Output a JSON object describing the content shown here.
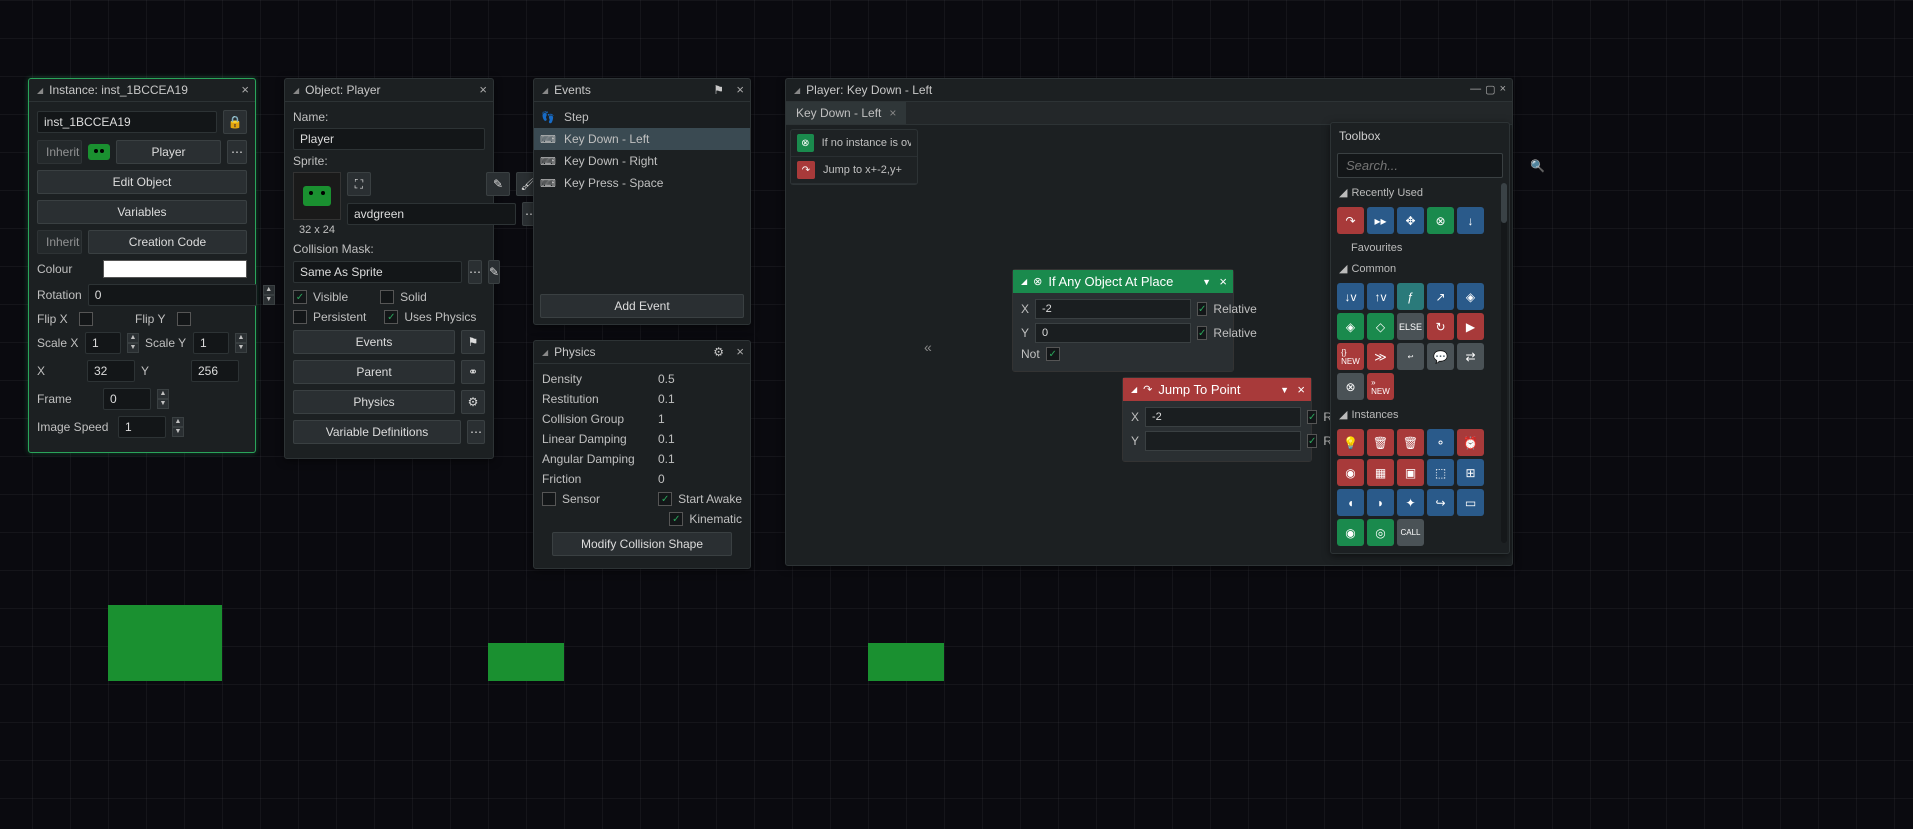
{
  "instance_panel": {
    "title": "Instance: inst_1BCCEA19",
    "name_value": "inst_1BCCEA19",
    "inherit_label": "Inherit",
    "object_name": "Player",
    "edit_object": "Edit Object",
    "variables": "Variables",
    "inherit2": "Inherit",
    "creation_code": "Creation Code",
    "colour_label": "Colour",
    "rotation_label": "Rotation",
    "rotation_value": "0",
    "flipx_label": "Flip X",
    "flipy_label": "Flip Y",
    "scalex_label": "Scale X",
    "scalex_value": "1",
    "scaley_label": "Scale Y",
    "scaley_value": "1",
    "x_label": "X",
    "x_value": "32",
    "y_label": "Y",
    "y_value": "256",
    "frame_label": "Frame",
    "frame_value": "0",
    "imgspeed_label": "Image Speed",
    "imgspeed_value": "1"
  },
  "object_panel": {
    "title": "Object: Player",
    "name_label": "Name:",
    "name_value": "Player",
    "sprite_label": "Sprite:",
    "sprite_name": "avdgreen",
    "sprite_size": "32 x 24",
    "collision_label": "Collision Mask:",
    "collision_value": "Same As Sprite",
    "visible": "Visible",
    "solid": "Solid",
    "persistent": "Persistent",
    "uses_physics": "Uses Physics",
    "events_btn": "Events",
    "parent_btn": "Parent",
    "physics_btn": "Physics",
    "vardef_btn": "Variable Definitions"
  },
  "events_panel": {
    "title": "Events",
    "items": [
      {
        "label": "Step",
        "icon": "👣"
      },
      {
        "label": "Key Down - Left",
        "icon": "⌨"
      },
      {
        "label": "Key Down - Right",
        "icon": "⌨"
      },
      {
        "label": "Key Press - Space",
        "icon": "⌨"
      }
    ],
    "selected_index": 1,
    "add_event": "Add Event"
  },
  "physics_panel": {
    "title": "Physics",
    "density_label": "Density",
    "density_value": "0.5",
    "restitution_label": "Restitution",
    "restitution_value": "0.1",
    "group_label": "Collision Group",
    "group_value": "1",
    "lindamp_label": "Linear Damping",
    "lindamp_value": "0.1",
    "angdamp_label": "Angular Damping",
    "angdamp_value": "0.1",
    "friction_label": "Friction",
    "friction_value": "0",
    "sensor": "Sensor",
    "start_awake": "Start Awake",
    "kinematic": "Kinematic",
    "modify_shape": "Modify Collision Shape"
  },
  "player_panel": {
    "title": "Player: Key Down - Left",
    "tab_label": "Key Down - Left",
    "strip_items": [
      {
        "label": "If no instance is ove",
        "color": "green",
        "glyph": "⊗"
      },
      {
        "label": "Jump to x+-2,y+",
        "color": "red",
        "glyph": "↷"
      }
    ]
  },
  "action_if": {
    "title": "If Any Object At Place",
    "x_label": "X",
    "x_value": "-2",
    "x_relative": "Relative",
    "y_label": "Y",
    "y_value": "0",
    "y_relative": "Relative",
    "not_label": "Not"
  },
  "action_jump": {
    "title": "Jump To Point",
    "x_label": "X",
    "x_value": "-2",
    "x_relative": "Relative",
    "y_label": "Y",
    "y_value": "",
    "y_relative": "Relative"
  },
  "toolbox": {
    "title": "Toolbox",
    "search_placeholder": "Search...",
    "recently_used": "Recently Used",
    "favourites": "Favourites",
    "common": "Common",
    "instances": "Instances"
  },
  "colors": {
    "green": "#1a8a4d",
    "red": "#a83a3a",
    "blue": "#2a5a8a",
    "grey": "#4a5256"
  }
}
